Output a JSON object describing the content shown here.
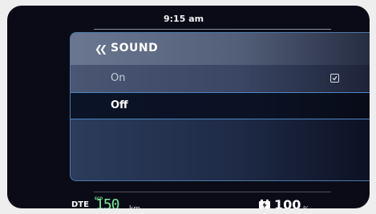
{
  "status_bar": {
    "time": "9:15 am"
  },
  "menu": {
    "title": "SOUND",
    "back_icon": "double-chevron-left-icon",
    "options": [
      {
        "label": "On",
        "checked": true
      },
      {
        "label": "Off",
        "checked": false
      }
    ],
    "highlighted_option": "Off",
    "accent_color": "#4f86c2"
  },
  "footer": {
    "dte_label": "DTE",
    "eco_label": "ECO",
    "dte_value": "150",
    "dte_unit": "km",
    "dte_color": "#7ee89a",
    "battery_icon": "battery-charging-icon",
    "battery_value": "100",
    "battery_unit": "%"
  }
}
